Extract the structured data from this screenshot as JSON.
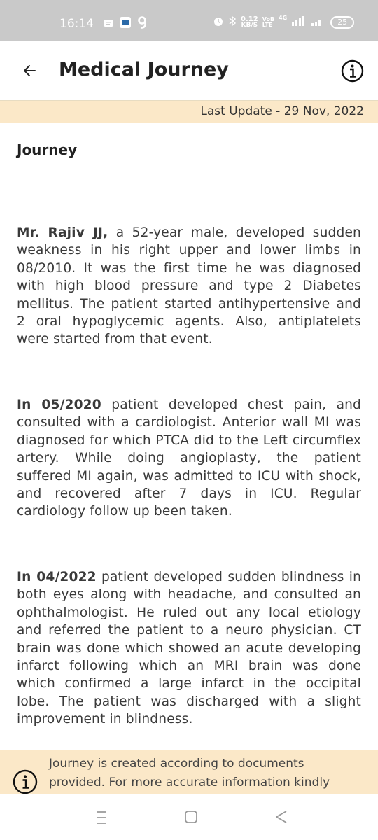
{
  "status_bar": {
    "time": "16:14",
    "net_speed_value": "0.12",
    "net_speed_unit": "KB/S",
    "vo_top": "VoB",
    "vo_bottom": "LTE",
    "network_type": "4G",
    "battery": "25"
  },
  "header": {
    "title": "Medical Journey",
    "back_icon": "back-arrow-icon",
    "info_icon": "info-icon"
  },
  "update_banner": {
    "text": "Last Update - 29 Nov, 2022"
  },
  "journey": {
    "heading": "Journey",
    "entries": [
      {
        "bold": "Mr. Rajiv JJ,",
        "text": " a 52-year male, developed sudden weakness in his right upper and lower limbs in 08/2010. It was the first time he was diagnosed with high blood pressure and type 2 Diabetes mellitus. The patient started antihypertensive and 2 oral hypoglycemic agents. Also, antiplatelets were started from that event."
      },
      {
        "bold": "In 05/2020",
        "text": " patient developed chest pain, and consulted with a cardiologist. Anterior wall MI was diagnosed for which PTCA did to the Left circumflex artery. While doing angioplasty, the patient suffered MI again, was admitted to ICU with shock, and recovered after 7 days in ICU. Regular cardiology follow up been taken."
      },
      {
        "bold": "In 04/2022",
        "text": " patient developed sudden blindness in both eyes along with headache, and consulted an ophthalmologist. He ruled out any local etiology and referred the patient to a neuro physician. CT brain was done which showed an acute developing infarct following which an MRI brain was done which confirmed a large infarct in the occipital lobe. The patient was discharged with a slight improvement in blindness."
      }
    ]
  },
  "disclaimer": {
    "text": "Journey is created according to documents provided. For more accurate information kindly"
  },
  "colors": {
    "accent_banner": "#fbe8c8",
    "status_bar": "#c9c9c9"
  }
}
